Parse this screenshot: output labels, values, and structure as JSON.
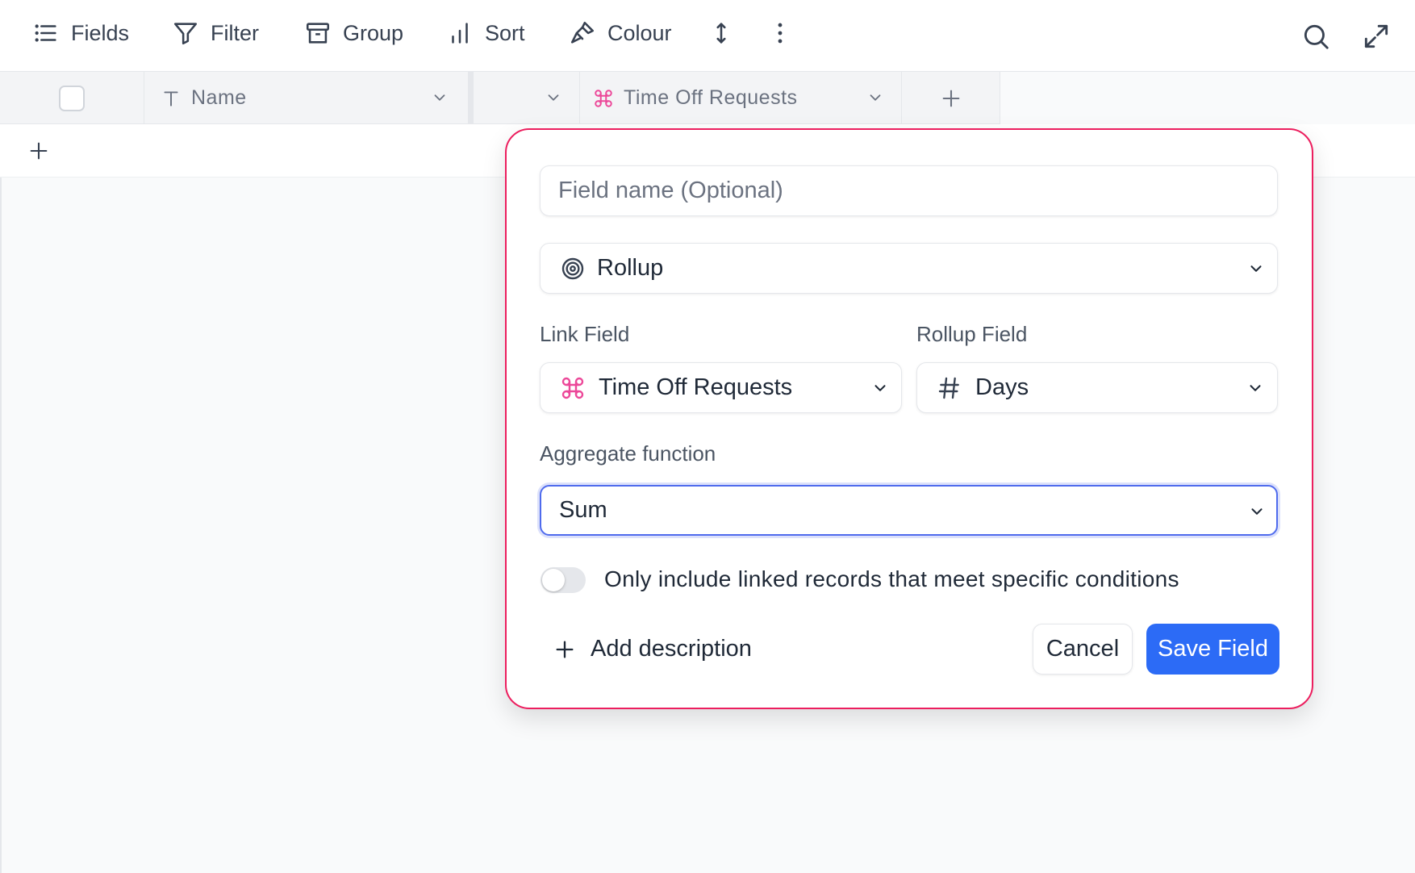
{
  "toolbar": {
    "fields": "Fields",
    "filter": "Filter",
    "group": "Group",
    "sort": "Sort",
    "colour": "Colour"
  },
  "grid": {
    "columns": [
      {
        "label": "Name",
        "icon": "text-type-icon"
      },
      {
        "label": "",
        "icon": "chevron-down-icon"
      },
      {
        "label": "Time Off Requests",
        "icon": "link-icon"
      }
    ]
  },
  "popup": {
    "field_name_placeholder": "Field name (Optional)",
    "field_type": "Rollup",
    "link_field_label": "Link Field",
    "link_field_value": "Time Off Requests",
    "rollup_field_label": "Rollup Field",
    "rollup_field_value": "Days",
    "aggregate_label": "Aggregate function",
    "aggregate_value": "Sum",
    "condition_toggle_label": "Only include linked records that meet specific conditions",
    "condition_toggle_on": false,
    "add_description": "Add description",
    "cancel": "Cancel",
    "save": "Save Field"
  },
  "colors": {
    "accent_pink": "#ec1e5e",
    "primary_blue": "#2c6bf6",
    "link_icon": "#ec4899"
  }
}
